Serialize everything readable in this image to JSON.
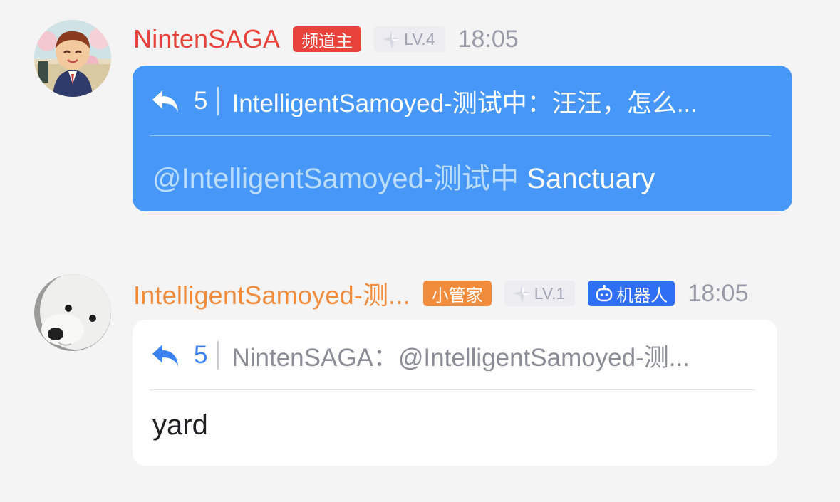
{
  "messages": [
    {
      "author": "NintenSAGA",
      "role_badge": "频道主",
      "level": "LV.4",
      "time": "18:05",
      "reply_count": "5",
      "quote_text": "IntelligentSamoyed-测试中：汪汪，怎么...",
      "mention": "@IntelligentSamoyed-测试中",
      "body": "Sanctuary",
      "colors": {
        "name": "#e8423a",
        "badge": "#e8423a",
        "bubble": "#4797f8"
      }
    },
    {
      "author": "IntelligentSamoyed-测...",
      "role_badge": "小管家",
      "level": "LV.1",
      "bot_badge": "机器人",
      "time": "18:05",
      "reply_count": "5",
      "quote_text": "NintenSAGA：@IntelligentSamoyed-测...",
      "body": "yard",
      "colors": {
        "name": "#f08c3c",
        "badge": "#f08c3c",
        "bot_badge": "#2f6ff5",
        "bubble": "#ffffff"
      }
    }
  ]
}
